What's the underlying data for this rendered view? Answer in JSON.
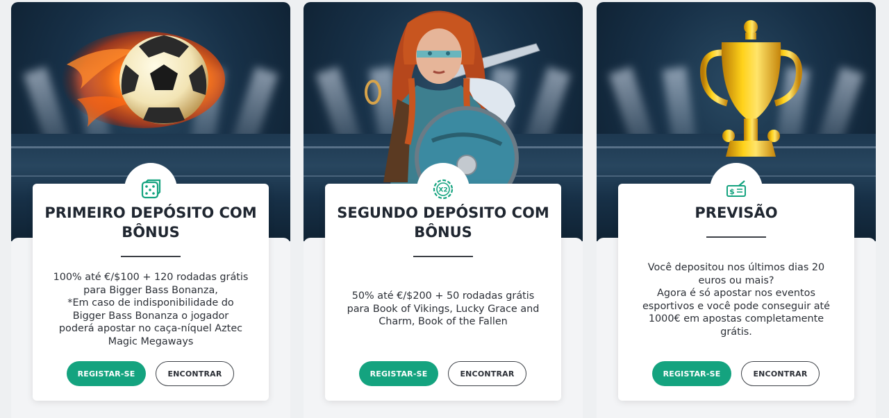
{
  "accent_color": "#14a37f",
  "cards": [
    {
      "icon": "dice-icon",
      "title": "PRIMEIRO DEPÓSITO COM BÔNUS",
      "description": "100% até €/$100 + 120 rodadas grátis\npara Bigger Bass Bonanza,\n*Em caso de indisponibilidade do\nBigger Bass Bonanza o jogador\npoderá apostar no caça-níquel Aztec\nMagic Megaways",
      "register_label": "REGISTAR-SE",
      "find_label": "ENCONTRAR"
    },
    {
      "icon": "x2-multiplier-icon",
      "title": "SEGUNDO DEPÓSITO COM BÔNUS",
      "description": "50% até €/$200 + 50 rodadas grátis\npara Book of Vikings, Lucky Grace and\nCharm, Book of the Fallen",
      "register_label": "REGISTAR-SE",
      "find_label": "ENCONTRAR"
    },
    {
      "icon": "money-ticket-icon",
      "title": "PREVISÃO",
      "description": "Você depositou nos últimos dias 20\neuros ou mais?\nAgora é só apostar nos eventos\nesportivos e você pode conseguir até\n1000€ em apostas completamente\ngrátis.",
      "register_label": "REGISTAR-SE",
      "find_label": "ENCONTRAR"
    }
  ]
}
